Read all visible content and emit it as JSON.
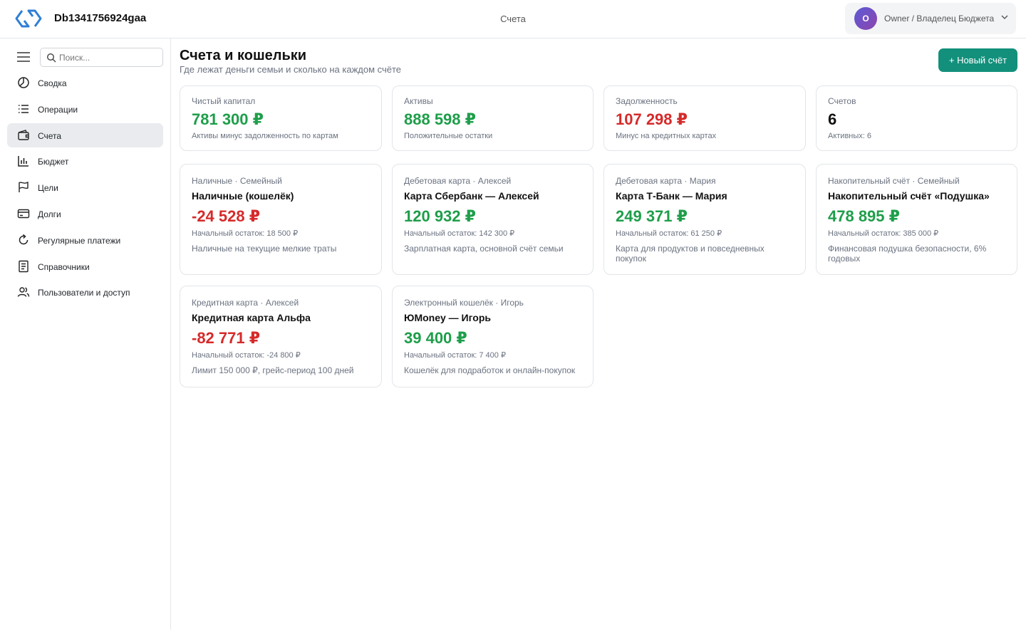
{
  "header": {
    "app_name": "Db1341756924gaa",
    "page_title": "Счета",
    "user": {
      "initial": "O",
      "name": "Owner / Владелец Бюджета"
    }
  },
  "sidebar": {
    "search_placeholder": "Поиск...",
    "items": [
      {
        "label": "Сводка",
        "icon": "chart-pie-icon"
      },
      {
        "label": "Операции",
        "icon": "list-icon"
      },
      {
        "label": "Счета",
        "icon": "wallet-icon",
        "active": true
      },
      {
        "label": "Бюджет",
        "icon": "bar-chart-icon"
      },
      {
        "label": "Цели",
        "icon": "flag-icon"
      },
      {
        "label": "Долги",
        "icon": "credit-card-icon"
      },
      {
        "label": "Регулярные платежи",
        "icon": "refresh-icon"
      },
      {
        "label": "Справочники",
        "icon": "book-icon"
      },
      {
        "label": "Пользователи и доступ",
        "icon": "users-icon"
      }
    ]
  },
  "main": {
    "title": "Счета и кошельки",
    "subtitle": "Где лежат деньги семьи и сколько на каждом счёте",
    "new_button": "+ Новый счёт",
    "summary": [
      {
        "label": "Чистый капитал",
        "value": "781 300 ₽",
        "note": "Активы минус задолженность по картам",
        "tone": "pos"
      },
      {
        "label": "Активы",
        "value": "888 598 ₽",
        "note": "Положительные остатки",
        "tone": "pos"
      },
      {
        "label": "Задолженность",
        "value": "107 298 ₽",
        "note": "Минус на кредитных картах",
        "tone": "neg"
      },
      {
        "label": "Счетов",
        "value": "6",
        "note": "Активных: 6",
        "tone": "neutral"
      }
    ],
    "accounts": [
      {
        "type": "Наличные · Семейный",
        "name": "Наличные (кошелёк)",
        "balance": "-24 528 ₽",
        "initial": "Начальный остаток: 18 500 ₽",
        "desc": "Наличные на текущие мелкие траты",
        "tone": "neg"
      },
      {
        "type": "Дебетовая карта · Алексей",
        "name": "Карта Сбербанк — Алексей",
        "balance": "120 932 ₽",
        "initial": "Начальный остаток: 142 300 ₽",
        "desc": "Зарплатная карта, основной счёт семьи",
        "tone": "pos"
      },
      {
        "type": "Дебетовая карта · Мария",
        "name": "Карта Т-Банк — Мария",
        "balance": "249 371 ₽",
        "initial": "Начальный остаток: 61 250 ₽",
        "desc": "Карта для продуктов и повседневных покупок",
        "tone": "pos"
      },
      {
        "type": "Накопительный счёт · Семейный",
        "name": "Накопительный счёт «Подушка»",
        "balance": "478 895 ₽",
        "initial": "Начальный остаток: 385 000 ₽",
        "desc": "Финансовая подушка безопасности, 6% годовых",
        "tone": "pos"
      },
      {
        "type": "Кредитная карта · Алексей",
        "name": "Кредитная карта Альфа",
        "balance": "-82 771 ₽",
        "initial": "Начальный остаток: -24 800 ₽",
        "desc": "Лимит 150 000 ₽, грейс-период 100 дней",
        "tone": "neg"
      },
      {
        "type": "Электронный кошелёк · Игорь",
        "name": "ЮMoney — Игорь",
        "balance": "39 400 ₽",
        "initial": "Начальный остаток: 7 400 ₽",
        "desc": "Кошелёк для подработок и онлайн-покупок",
        "tone": "pos"
      }
    ]
  }
}
